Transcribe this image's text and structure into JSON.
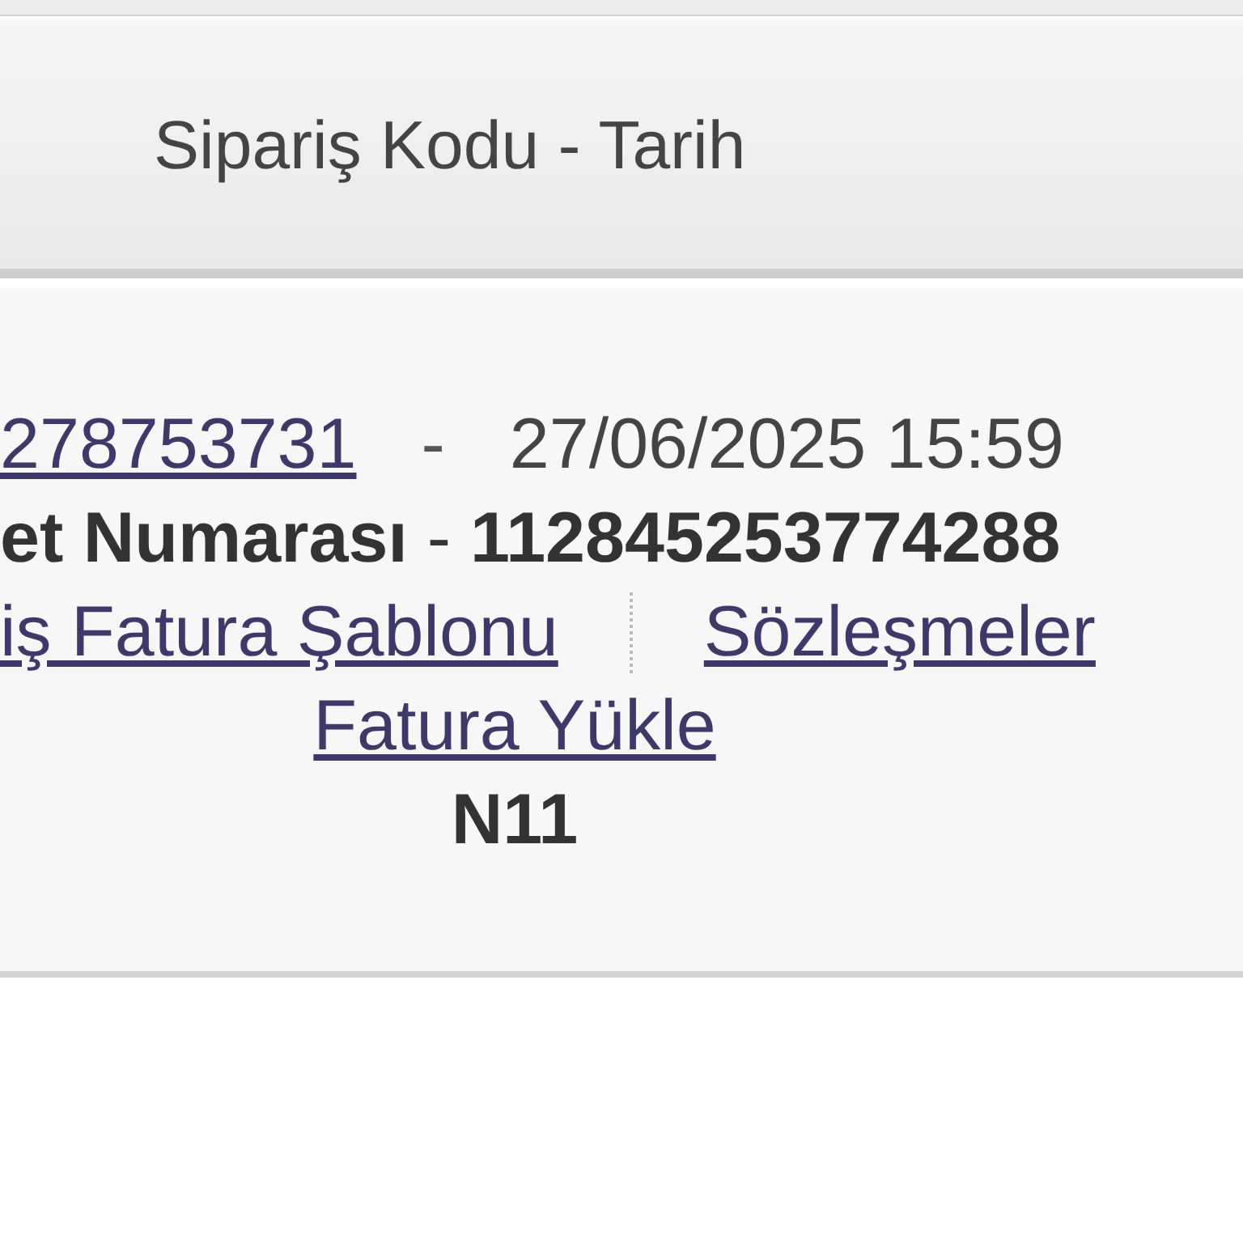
{
  "table": {
    "columns": [
      {
        "label": "Sipariş Kodu - Tarih"
      }
    ],
    "rows": [
      {
        "order_code": "278753731",
        "separator": "-",
        "date": "27/06/2025 15:59",
        "package_label": "et Numarası",
        "package_separator": "-",
        "package_number": "112845253774288",
        "links": [
          {
            "label": "iş Fatura Şablonu"
          },
          {
            "label": "Sözleşmeler"
          }
        ],
        "upload_link": "Fatura Yükle",
        "marketplace": "N11"
      }
    ]
  }
}
